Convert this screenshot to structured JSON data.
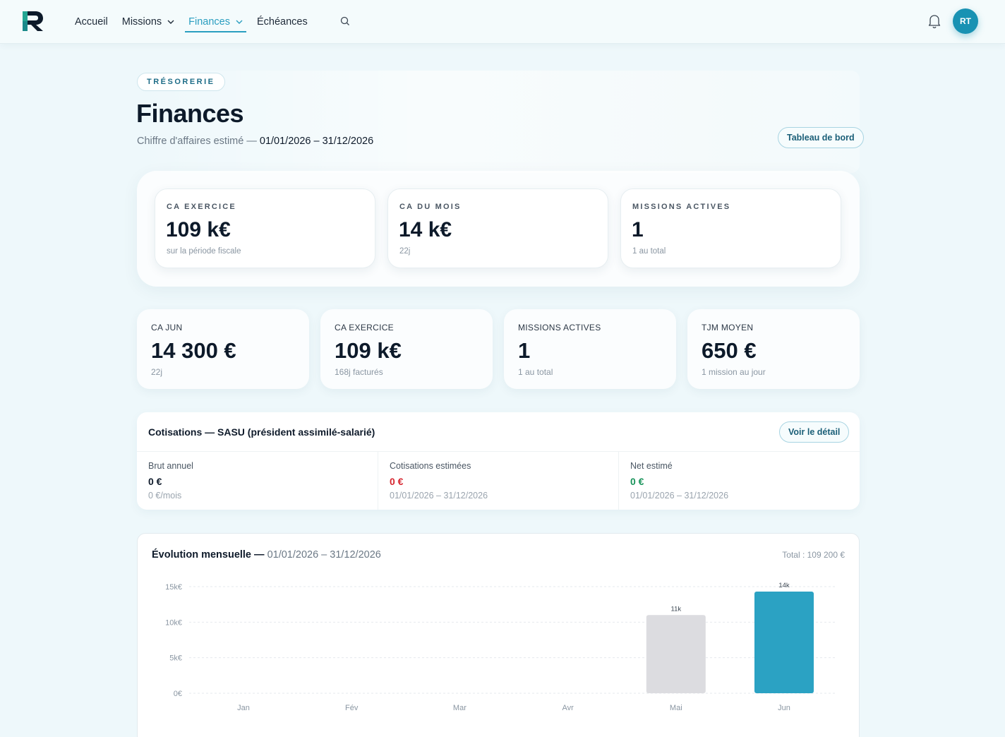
{
  "nav": {
    "items": [
      {
        "label": "Accueil",
        "dropdown": false,
        "active": false
      },
      {
        "label": "Missions",
        "dropdown": true,
        "active": false
      },
      {
        "label": "Finances",
        "dropdown": true,
        "active": true
      },
      {
        "label": "Échéances",
        "dropdown": false,
        "active": false
      }
    ],
    "avatar_initials": "RT"
  },
  "header": {
    "badge": "TRÉSORERIE",
    "title": "Finances",
    "subtitle_prefix": "Chiffre d'affaires estimé — ",
    "subtitle_period": "01/01/2026 – 31/12/2026",
    "dashboard_button": "Tableau de bord"
  },
  "kpis_top": [
    {
      "label": "CA EXERCICE",
      "value": "109 k€",
      "sub": "sur la période fiscale"
    },
    {
      "label": "CA DU MOIS",
      "value": "14 k€",
      "sub": "22j"
    },
    {
      "label": "MISSIONS ACTIVES",
      "value": "1",
      "sub": "1 au total"
    }
  ],
  "kpis_small": [
    {
      "label": "CA JUN",
      "value": "14 300 €",
      "sub": "22j"
    },
    {
      "label": "CA EXERCICE",
      "value": "109 k€",
      "sub": "168j facturés"
    },
    {
      "label": "MISSIONS ACTIVES",
      "value": "1",
      "sub": "1 au total"
    },
    {
      "label": "TJM MOYEN",
      "value": "650 €",
      "sub": "1 mission au jour"
    }
  ],
  "cotisations": {
    "title": "Cotisations — SASU (président assimilé-salarié)",
    "detail_button": "Voir le détail",
    "columns": [
      {
        "label": "Brut annuel",
        "value": "0 €",
        "sub": "0 €/mois",
        "color": "#0f1b2b"
      },
      {
        "label": "Cotisations estimées",
        "value": "0 €",
        "sub": "01/01/2026 – 31/12/2026",
        "color": "#d6262f"
      },
      {
        "label": "Net estimé",
        "value": "0 €",
        "sub": "01/01/2026 – 31/12/2026",
        "color": "#18935a"
      }
    ]
  },
  "chart_section": {
    "title": "Évolution mensuelle — ",
    "period": "01/01/2026 – 31/12/2026",
    "total": "Total : 109 200 €"
  },
  "chart_data": {
    "type": "bar",
    "categories": [
      "Jan",
      "Fév",
      "Mar",
      "Avr",
      "Mai",
      "Jun"
    ],
    "values": [
      0,
      0,
      0,
      0,
      11000,
      14300
    ],
    "bar_labels": [
      "",
      "",
      "",
      "",
      "11k",
      "14k"
    ],
    "bar_colors": [
      "#dcdce0",
      "#dcdce0",
      "#dcdce0",
      "#dcdce0",
      "#dcdce0",
      "#2ba2c3"
    ],
    "yticks": [
      0,
      5000,
      10000,
      15000
    ],
    "ytick_labels": [
      "0€",
      "5k€",
      "10k€",
      "15k€"
    ],
    "ylim": [
      0,
      15000
    ],
    "grid": true
  }
}
